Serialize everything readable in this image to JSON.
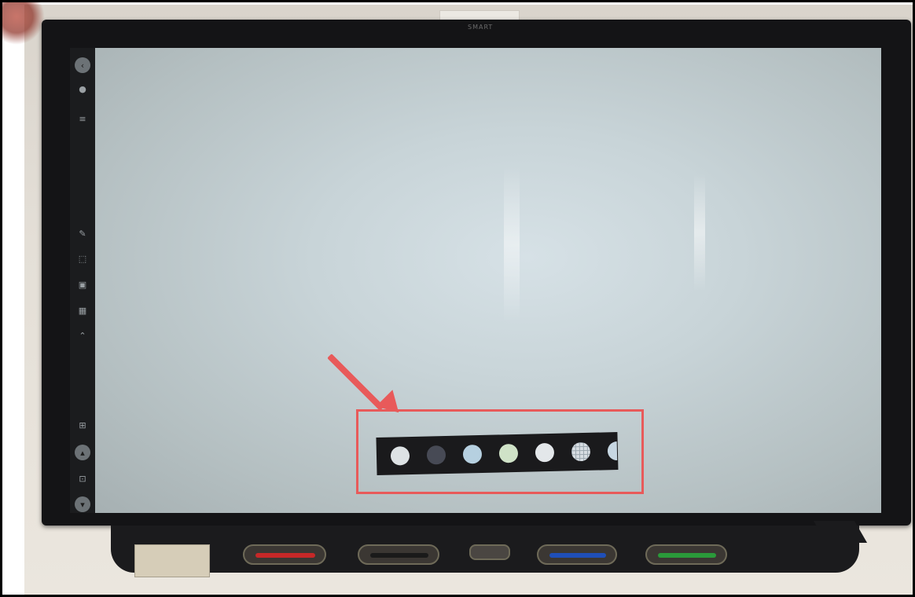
{
  "brand_text": "SMART",
  "sidebar_icons": [
    "back-icon",
    "bell-icon",
    "menu-badge-icon",
    "pen-icon",
    "select-rectangle-icon",
    "screen-capture-icon",
    "grid-icon",
    "chevron-icon",
    "add-page-icon",
    "up-circle-icon",
    "new-page-icon",
    "down-circle-icon"
  ],
  "background_swatches": [
    {
      "name": "white",
      "color": "#dde2e4"
    },
    {
      "name": "dark",
      "color": "#474a55"
    },
    {
      "name": "light-blue",
      "color": "#b6d0e0"
    },
    {
      "name": "light-green",
      "color": "#cfe2c7"
    },
    {
      "name": "light-gray",
      "color": "#e3e7ea"
    },
    {
      "name": "gridded",
      "color": "#d7dde2"
    },
    {
      "name": "partial",
      "color": "#c7d7e2"
    }
  ],
  "pen_tray": {
    "pens": [
      {
        "name": "red",
        "color": "#c62828"
      },
      {
        "name": "black",
        "color": "#1a1a1a"
      },
      {
        "name": "blue",
        "color": "#1f4fb8"
      },
      {
        "name": "green",
        "color": "#2a9a3a"
      }
    ]
  },
  "annotation": {
    "color": "#e85a5a"
  }
}
